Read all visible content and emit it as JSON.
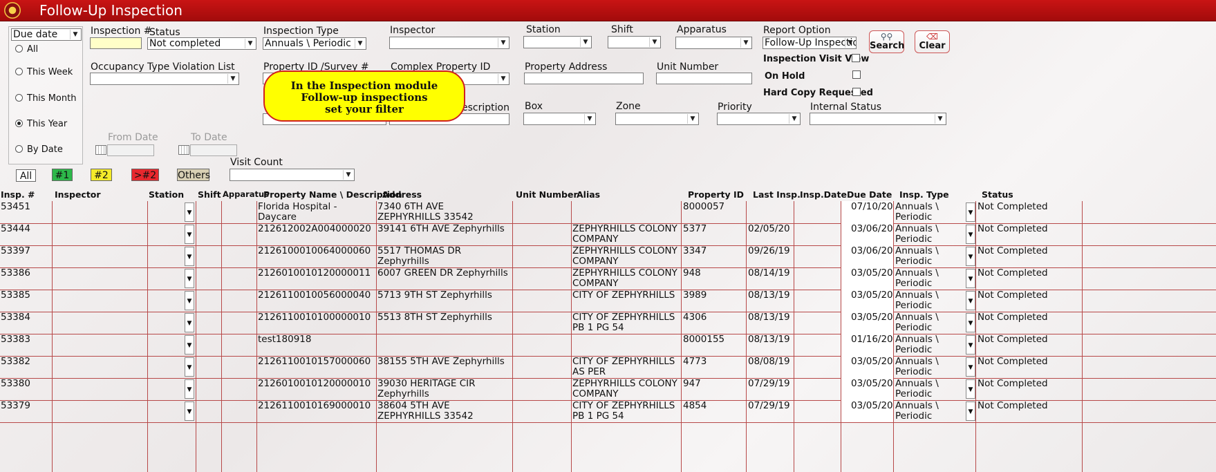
{
  "window": {
    "title": "Follow-Up Inspection"
  },
  "date_filter": {
    "selected": "Due date",
    "options": [
      {
        "label": "All",
        "checked": false
      },
      {
        "label": "This Week",
        "checked": false
      },
      {
        "label": "This Month",
        "checked": false
      },
      {
        "label": "This Year",
        "checked": true
      },
      {
        "label": "By Date",
        "checked": false
      }
    ],
    "from_date_label": "From Date",
    "to_date_label": "To Date"
  },
  "filters": {
    "inspection_number": {
      "label": "Inspection #",
      "value": ""
    },
    "status": {
      "label": "Status",
      "value": "Not completed"
    },
    "inspection_type": {
      "label": "Inspection Type",
      "value": "Annuals \\ Periodic"
    },
    "inspector": {
      "label": "Inspector",
      "value": ""
    },
    "station": {
      "label": "Station",
      "value": ""
    },
    "shift": {
      "label": "Shift",
      "value": ""
    },
    "apparatus": {
      "label": "Apparatus",
      "value": ""
    },
    "report_option": {
      "label": "Report Option",
      "value": "Follow-Up Inspection"
    },
    "occupancy_violation": {
      "label": "Occupancy Type Violation List",
      "value": ""
    },
    "property_id_survey": {
      "label": "Property ID /Survey #",
      "value": ""
    },
    "complex_property_id": {
      "label": "Complex Property ID",
      "value": ""
    },
    "property_address": {
      "label": "Property Address",
      "value": ""
    },
    "unit_number": {
      "label": "Unit Number",
      "value": ""
    },
    "description_label": "escription",
    "box": {
      "label": "Box",
      "value": ""
    },
    "zone": {
      "label": "Zone",
      "value": ""
    },
    "priority": {
      "label": "Priority",
      "value": ""
    },
    "internal_status": {
      "label": "Internal Status",
      "value": ""
    },
    "visit_count": {
      "label": "Visit Count",
      "value": ""
    }
  },
  "checkboxes": {
    "inspection_visit_view": "Inspection Visit View",
    "on_hold": "On Hold",
    "hard_copy_requested": "Hard Copy Requested"
  },
  "buttons": {
    "search": "Search",
    "clear": "Clear"
  },
  "priority_buttons": [
    {
      "label": "All",
      "color": "#ffffff"
    },
    {
      "label": "#1",
      "color": "#2db84a"
    },
    {
      "label": "#2",
      "color": "#f4ea2a"
    },
    {
      "label": ">#2",
      "color": "#e8282e"
    },
    {
      "label": "Others",
      "color": "#d8d0b4"
    }
  ],
  "callout": {
    "line1": "In the Inspection module",
    "line2": "Follow-up inspections",
    "line3": "set your filter"
  },
  "columns": [
    "Insp. #",
    "Inspector",
    "Station",
    "Shift",
    "Apparatus",
    "Property Name \\ Description",
    "Address",
    "Unit Number",
    "Alias",
    "Property ID",
    "Last Insp.",
    "Insp.Date",
    "Due Date",
    "Insp. Type",
    "Status"
  ],
  "rows": [
    {
      "insp": "53451",
      "name": "Florida Hospital - Daycare",
      "address": "7340 6TH AVE ZEPHYRHILLS 33542",
      "alias": "",
      "pid": "8000057",
      "last": "",
      "due": "07/10/20",
      "type": "Annuals \\ Periodic",
      "status": "Not Completed"
    },
    {
      "insp": "53444",
      "name": "212612002A004000020",
      "address": "39141 6TH AVE Zephyrhills",
      "alias": "ZEPHYRHILLS COLONY COMPANY",
      "pid": "5377",
      "last": "02/05/20",
      "due": "03/06/20",
      "type": "Annuals \\ Periodic",
      "status": "Not Completed"
    },
    {
      "insp": "53397",
      "name": "2126100010064000060",
      "address": "5517 THOMAS DR Zephyrhills",
      "alias": "ZEPHYRHILLS COLONY COMPANY",
      "pid": "3347",
      "last": "09/26/19",
      "due": "03/06/20",
      "type": "Annuals \\ Periodic",
      "status": "Not Completed"
    },
    {
      "insp": "53386",
      "name": "2126010010120000011",
      "address": "6007 GREEN DR Zephyrhills",
      "alias": "ZEPHYRHILLS COLONY COMPANY",
      "pid": "948",
      "last": "08/14/19",
      "due": "03/05/20",
      "type": "Annuals \\ Periodic",
      "status": "Not Completed"
    },
    {
      "insp": "53385",
      "name": "2126110010056000040",
      "address": "5713 9TH ST Zephyrhills",
      "alias": "CITY OF ZEPHYRHILLS",
      "pid": "3989",
      "last": "08/13/19",
      "due": "03/05/20",
      "type": "Annuals \\ Periodic",
      "status": "Not Completed"
    },
    {
      "insp": "53384",
      "name": "2126110010100000010",
      "address": "5513 8TH ST Zephyrhills",
      "alias": "CITY OF ZEPHYRHILLS PB 1 PG 54",
      "pid": "4306",
      "last": "08/13/19",
      "due": "03/05/20",
      "type": "Annuals \\ Periodic",
      "status": "Not Completed"
    },
    {
      "insp": "53383",
      "name": "test180918",
      "address": "",
      "alias": "",
      "pid": "8000155",
      "last": "08/13/19",
      "due": "01/16/20",
      "type": "Annuals \\ Periodic",
      "status": "Not Completed"
    },
    {
      "insp": "53382",
      "name": "2126110010157000060",
      "address": "38155 5TH AVE Zephyrhills",
      "alias": "CITY OF ZEPHYRHILLS AS PER",
      "pid": "4773",
      "last": "08/08/19",
      "due": "03/05/20",
      "type": "Annuals \\ Periodic",
      "status": "Not Completed"
    },
    {
      "insp": "53380",
      "name": "2126010010120000010",
      "address": "39030 HERITAGE CIR Zephyrhills",
      "alias": "ZEPHYRHILLS COLONY COMPANY",
      "pid": "947",
      "last": "07/29/19",
      "due": "03/05/20",
      "type": "Annuals \\ Periodic",
      "status": "Not Completed"
    },
    {
      "insp": "53379",
      "name": "2126110010169000010",
      "address": "38604 5TH AVE ZEPHYRHILLS 33542",
      "alias": "CITY OF ZEPHYRHILLS PB 1 PG 54",
      "pid": "4854",
      "last": "07/29/19",
      "due": "03/05/20",
      "type": "Annuals \\ Periodic",
      "status": "Not Completed"
    }
  ]
}
